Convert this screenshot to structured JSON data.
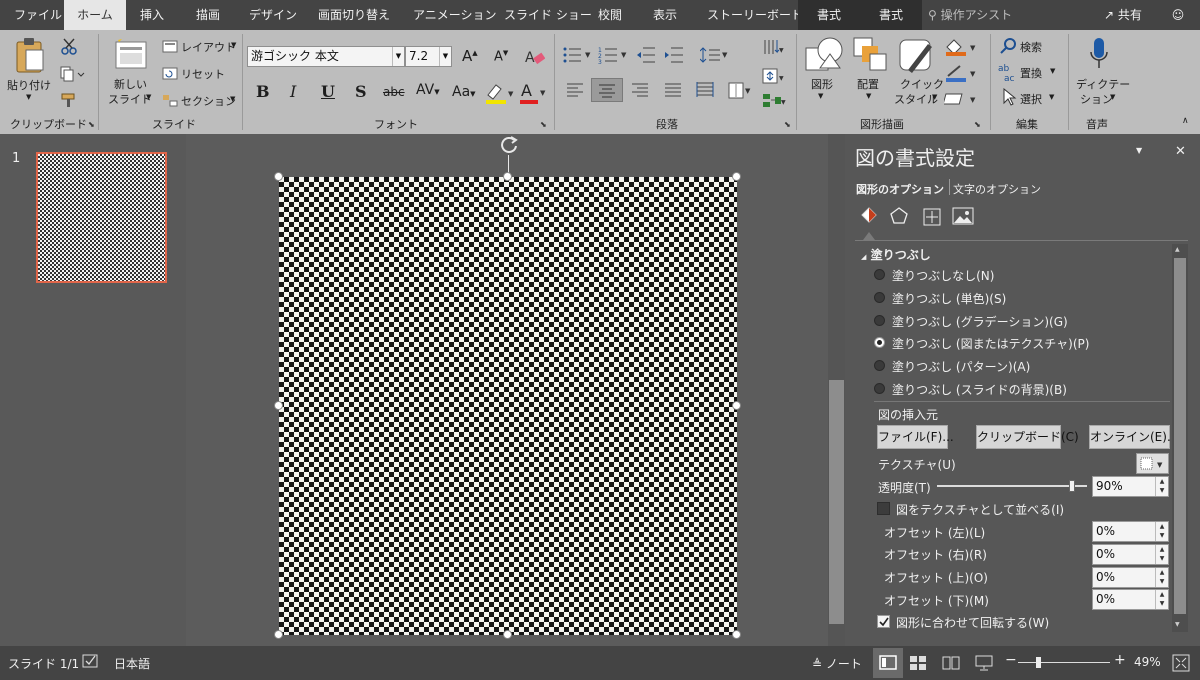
{
  "tabs": [
    "ファイル",
    "ホーム",
    "挿入",
    "描画",
    "デザイン",
    "画面切り替え",
    "アニメーション",
    "スライド ショー",
    "校閲",
    "表示",
    "ストーリーボード"
  ],
  "context_tabs": [
    "書式",
    "書式"
  ],
  "search_placeholder": "操作アシスト",
  "share_label": "共有",
  "ribbon": {
    "clipboard": {
      "paste": "貼り付け",
      "label": "クリップボード"
    },
    "slides": {
      "new_slide_1": "新しい",
      "new_slide_2": "スライド",
      "layout": "レイアウト",
      "reset": "リセット",
      "section": "セクション",
      "label": "スライド"
    },
    "font": {
      "font_name": "游ゴシック 本文",
      "font_size": "7.2",
      "bold": "B",
      "italic": "I",
      "underline": "U",
      "shadow": "S",
      "strike": "abc",
      "spacing": "AV",
      "case": "Aa",
      "label": "フォント"
    },
    "paragraph": {
      "label": "段落"
    },
    "drawing": {
      "shapes": "図形",
      "arrange": "配置",
      "quick_style_1": "クイック",
      "quick_style_2": "スタイル",
      "label": "図形描画"
    },
    "editing": {
      "find": "検索",
      "replace": "置換",
      "select": "選択",
      "label": "編集"
    },
    "voice": {
      "dictate_1": "ディクテー",
      "dictate_2": "ション",
      "label": "音声"
    }
  },
  "slide_thumb_number": "1",
  "pane": {
    "title": "図の書式設定",
    "tab_shape_options": "図形のオプション",
    "tab_text_options": "文字のオプション",
    "section_fill": "塗りつぶし",
    "fill_options": [
      "塗りつぶしなし(N)",
      "塗りつぶし (単色)(S)",
      "塗りつぶし (グラデーション)(G)",
      "塗りつぶし (図またはテクスチャ)(P)",
      "塗りつぶし (パターン)(A)",
      "塗りつぶし (スライドの背景)(B)"
    ],
    "fill_selected_index": 3,
    "insert_from": "図の挿入元",
    "btn_file": "ファイル(F)...",
    "btn_clipboard": "クリップボード(C)",
    "btn_online": "オンライン(E)...",
    "texture_label": "テクスチャ(U)",
    "transparency_label": "透明度(T)",
    "transparency_value": "90%",
    "transparency_fraction": 0.9,
    "tile_label": "図をテクスチャとして並べる(I)",
    "tile_checked": false,
    "offset_left_label": "オフセット (左)(L)",
    "offset_left_value": "0%",
    "offset_right_label": "オフセット (右)(R)",
    "offset_right_value": "0%",
    "offset_top_label": "オフセット (上)(O)",
    "offset_top_value": "0%",
    "offset_bottom_label": "オフセット (下)(M)",
    "offset_bottom_value": "0%",
    "rotate_label": "図形に合わせて回転する(W)",
    "rotate_checked": true
  },
  "status": {
    "slide_count": "スライド 1/1",
    "language": "日本語",
    "notes": "ノート",
    "zoom": "49%"
  },
  "colors": {
    "accent": "#c43e1c",
    "ribbon_bg": "#bdbdbd",
    "tabbar_bg": "#444444",
    "pane_bg": "#575757"
  }
}
